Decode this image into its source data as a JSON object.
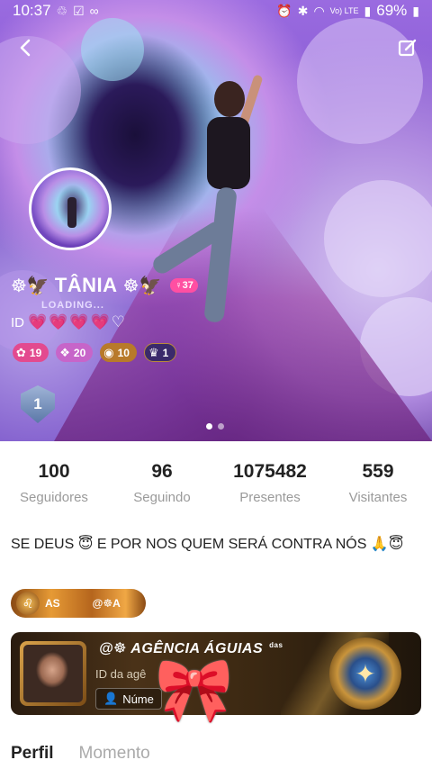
{
  "status_bar": {
    "time": "10:37",
    "battery": "69%",
    "left_icons": [
      "sync-icon",
      "check-box-icon",
      "voicemail-icon"
    ],
    "right_icons": [
      "alarm-icon",
      "bluetooth-icon",
      "wifi-icon",
      "signal-icon",
      "battery-icon"
    ],
    "network_label": "Vo) LTE"
  },
  "header": {
    "back_icon": "chevron-left-icon",
    "edit_icon": "edit-icon"
  },
  "profile": {
    "name": "TÂNIA",
    "name_decoration": "☸🦅",
    "gender_age_badge": "♀37",
    "loading_text": "LOADING...",
    "id_label": "ID",
    "id_hearts": [
      "💗",
      "💗",
      "💗",
      "💗",
      "♡"
    ],
    "levels": [
      {
        "icon": "star-icon",
        "value": "19",
        "color": "#e34a8f"
      },
      {
        "icon": "gem-icon",
        "value": "20",
        "color": "#c765c9"
      },
      {
        "icon": "medal-icon",
        "value": "10",
        "color": "#b87a2a"
      },
      {
        "icon": "crown-icon",
        "value": "1",
        "color": "#3a2a6b"
      }
    ],
    "rank_number": "1",
    "carousel_pages": 2,
    "carousel_active": 1
  },
  "stats": [
    {
      "value": "100",
      "label": "Seguidores"
    },
    {
      "value": "96",
      "label": "Seguindo"
    },
    {
      "value": "1075482",
      "label": "Presentes"
    },
    {
      "value": "559",
      "label": "Visitantes"
    }
  ],
  "bio": "SE DEUS 😇 E POR NOS QUEM SERÁ CONTRA NÓS 🙏😇",
  "badge_banner": {
    "text": "AS",
    "text2": "@☸A"
  },
  "agency": {
    "title": "@☸ AGÊNCIA ÁGUIAS",
    "subtitle": "das",
    "id_text": "ID da agê",
    "number_label": "Núme"
  },
  "tabs": [
    {
      "label": "Perfil",
      "active": true
    },
    {
      "label": "Momento",
      "active": false
    }
  ],
  "colors": {
    "accent": "#ff4fa2",
    "stat_label": "#9a9a9a"
  }
}
